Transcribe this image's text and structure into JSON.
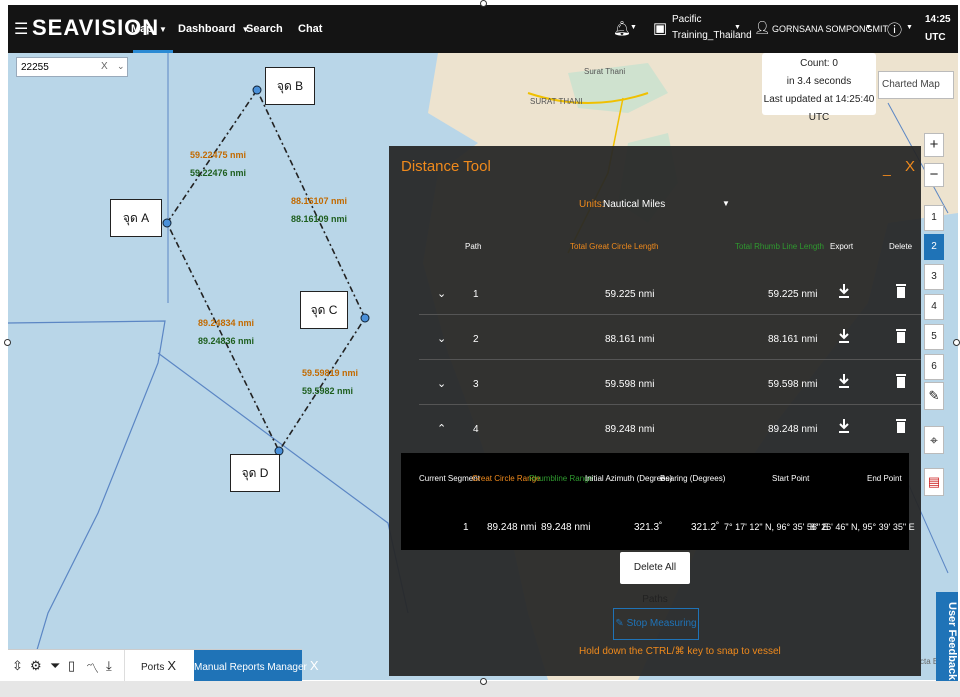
{
  "app": {
    "logo": "SEAVISION",
    "nav": [
      {
        "label": "Map",
        "has_menu": true
      },
      {
        "label": "Dashboard",
        "has_menu": true
      },
      {
        "label": "Search",
        "has_menu": false
      },
      {
        "label": "Chat",
        "has_menu": false
      }
    ],
    "notifications_icon": "bell-icon",
    "org_line1": "Pacific",
    "org_line2": "Training_Thailand",
    "user": "GORNSANA SOMPONGMIT",
    "time": "14:25",
    "timezone": "UTC",
    "accent": "#1f73b7"
  },
  "map": {
    "vessel_search": {
      "value": "22255",
      "clear": "X"
    },
    "status": {
      "count": "Count: 0",
      "duration": "in 3.4 seconds",
      "updated": "Last updated at 14:25:40 UTC"
    },
    "layer_button": "Charted Map",
    "place_labels": [
      "Surat Thani",
      "SURAT THANI"
    ],
    "points": [
      {
        "label": "จุด A"
      },
      {
        "label": "จุด B"
      },
      {
        "label": "จุด C"
      },
      {
        "label": "จุด D"
      }
    ],
    "segment_distances": [
      {
        "great_circle": "59.22475 nmi",
        "rhumb": "59.22476 nmi"
      },
      {
        "great_circle": "88.16107 nmi",
        "rhumb": "88.16109 nmi"
      },
      {
        "great_circle": "59.59819 nmi",
        "rhumb": "59.5982 nmi"
      },
      {
        "great_circle": "89.24834 nmi",
        "rhumb": "89.24836 nmi"
      }
    ],
    "zoom_in": "+",
    "zoom_out": "−",
    "layers": [
      "1",
      "2",
      "3",
      "4",
      "5",
      "6"
    ],
    "active_layer": "2",
    "user_feedback": "User Feedback",
    "attribution": "cta E"
  },
  "distance_tool": {
    "title": "Distance Tool",
    "minimize": "_",
    "close": "X",
    "units_label": "Units:",
    "units_value": "Nautical Miles",
    "headers": {
      "path": "Path",
      "great_circle": "Total Great Circle Length",
      "rhumb": "Total Rhumb Line Length",
      "export": "Export",
      "delete": "Delete"
    },
    "paths": [
      {
        "num": "1",
        "great_circle": "59.225 nmi",
        "rhumb": "59.225 nmi",
        "expanded": false
      },
      {
        "num": "2",
        "great_circle": "88.161 nmi",
        "rhumb": "88.161 nmi",
        "expanded": false
      },
      {
        "num": "3",
        "great_circle": "59.598 nmi",
        "rhumb": "59.598 nmi",
        "expanded": false
      },
      {
        "num": "4",
        "great_circle": "89.248 nmi",
        "rhumb": "89.248 nmi",
        "expanded": true
      }
    ],
    "segment_headers": {
      "current_segment": "Current Segment",
      "great_circle_range": "Great Circle Range",
      "rhumbline_range": "Rhumbline Range",
      "initial_azimuth": "Initial Azimuth (Degrees)",
      "bearing": "Bearing (Degrees)",
      "start_point": "Start Point",
      "end_point": "End Point"
    },
    "segment": {
      "current_segment": "1",
      "great_circle_range": "89.248 nmi",
      "rhumbline_range": "89.248 nmi",
      "initial_azimuth": "321.3˚",
      "bearing": "321.2˚",
      "start_point": "7° 17' 12\" N, 96° 35' 56\" E",
      "end_point": "8° 26' 46\" N, 95° 39' 35\" E"
    },
    "delete_all": "Delete All Paths",
    "stop_measuring": "Stop Measuring",
    "snap_hint": "Hold down the CTRL/⌘ key to snap to vessel",
    "orange": "#f08a1c",
    "green": "#2f9a2f"
  },
  "bottom_bar": {
    "tabs": [
      {
        "label": "Ports",
        "close": "X"
      },
      {
        "label": "Manual Reports Manager",
        "close": "X"
      }
    ]
  }
}
